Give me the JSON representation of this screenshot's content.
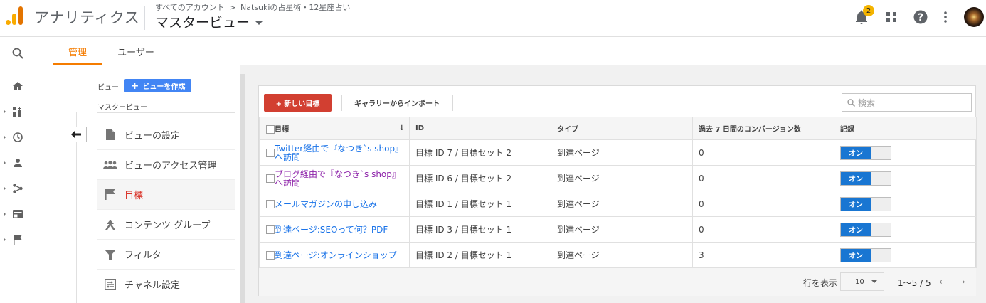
{
  "app": {
    "name": "アナリティクス",
    "breadcrumb_all": "すべてのアカウント",
    "breadcrumb_sep": ">",
    "breadcrumb_property": "Natsukiの占星術・12星座占い",
    "view_title": "マスタービュー"
  },
  "topbar": {
    "notification_count": "2",
    "icons": [
      "bell-icon",
      "apps-icon",
      "help-icon",
      "more-vert-icon",
      "avatar"
    ]
  },
  "leftnav": {
    "icons": [
      "search-icon",
      "home-icon",
      "customization-icon",
      "realtime-icon",
      "audience-icon",
      "acquisition-icon",
      "behavior-icon",
      "conversions-icon"
    ]
  },
  "tabs": [
    {
      "label": "管理",
      "active": true
    },
    {
      "label": "ユーザー",
      "active": false
    }
  ],
  "settings": {
    "view_label": "ビュー",
    "create_view_label": "ビューを作成",
    "view_name": "マスタービュー",
    "menu": [
      {
        "label": "ビューの設定",
        "icon": "document-icon"
      },
      {
        "label": "ビューのアクセス管理",
        "icon": "people-icon"
      },
      {
        "label": "目標",
        "icon": "flag-icon",
        "active": true
      },
      {
        "label": "コンテンツ グループ",
        "icon": "grouping-icon"
      },
      {
        "label": "フィルタ",
        "icon": "filter-icon"
      },
      {
        "label": "チャネル設定",
        "icon": "channel-icon"
      }
    ]
  },
  "toolbar": {
    "new_goal_label": "+ 新しい目標",
    "import_label": "ギャラリーからインポート",
    "search_placeholder": "検索"
  },
  "table": {
    "columns": [
      "目標",
      "ID",
      "タイプ",
      "過去 7 日間のコンバージョン数",
      "記録"
    ],
    "rows": [
      {
        "goal_line1": "Twitter経由で『なつき`s shop』",
        "goal_line2": "へ訪問",
        "id": "目標 ID 7 / 目標セット 2",
        "type": "到達ページ",
        "conversions": "0",
        "recording": "オン",
        "visited": false
      },
      {
        "goal_line1": "ブログ経由で『なつき`s shop』",
        "goal_line2": "へ訪問",
        "id": "目標 ID 6 / 目標セット 2",
        "type": "到達ページ",
        "conversions": "0",
        "recording": "オン",
        "visited": true
      },
      {
        "goal_line1": "メールマガジンの申し込み",
        "goal_line2": "",
        "id": "目標 ID 1 / 目標セット 1",
        "type": "到達ページ",
        "conversions": "0",
        "recording": "オン",
        "visited": false
      },
      {
        "goal_line1": "到達ページ:SEOって何？PDF",
        "goal_line2": "",
        "id": "目標 ID 3 / 目標セット 1",
        "type": "到達ページ",
        "conversions": "0",
        "recording": "オン",
        "visited": false
      },
      {
        "goal_line1": "到達ページ:オンラインショップ",
        "goal_line2": "",
        "id": "目標 ID 2 / 目標セット 1",
        "type": "到達ページ",
        "conversions": "3",
        "recording": "オン",
        "visited": false
      }
    ]
  },
  "footer": {
    "rows_label": "行を表示",
    "rows_value": "10",
    "page_range": "1～5 / 5",
    "prev": "‹",
    "next": "›"
  },
  "colors": {
    "accent_orange": "#f57c00",
    "new_button": "#d23f31",
    "toggle_on": "#1976d2",
    "link": "#1a73e8",
    "visited_link": "#8e24aa",
    "active_menu": "#d93025"
  }
}
